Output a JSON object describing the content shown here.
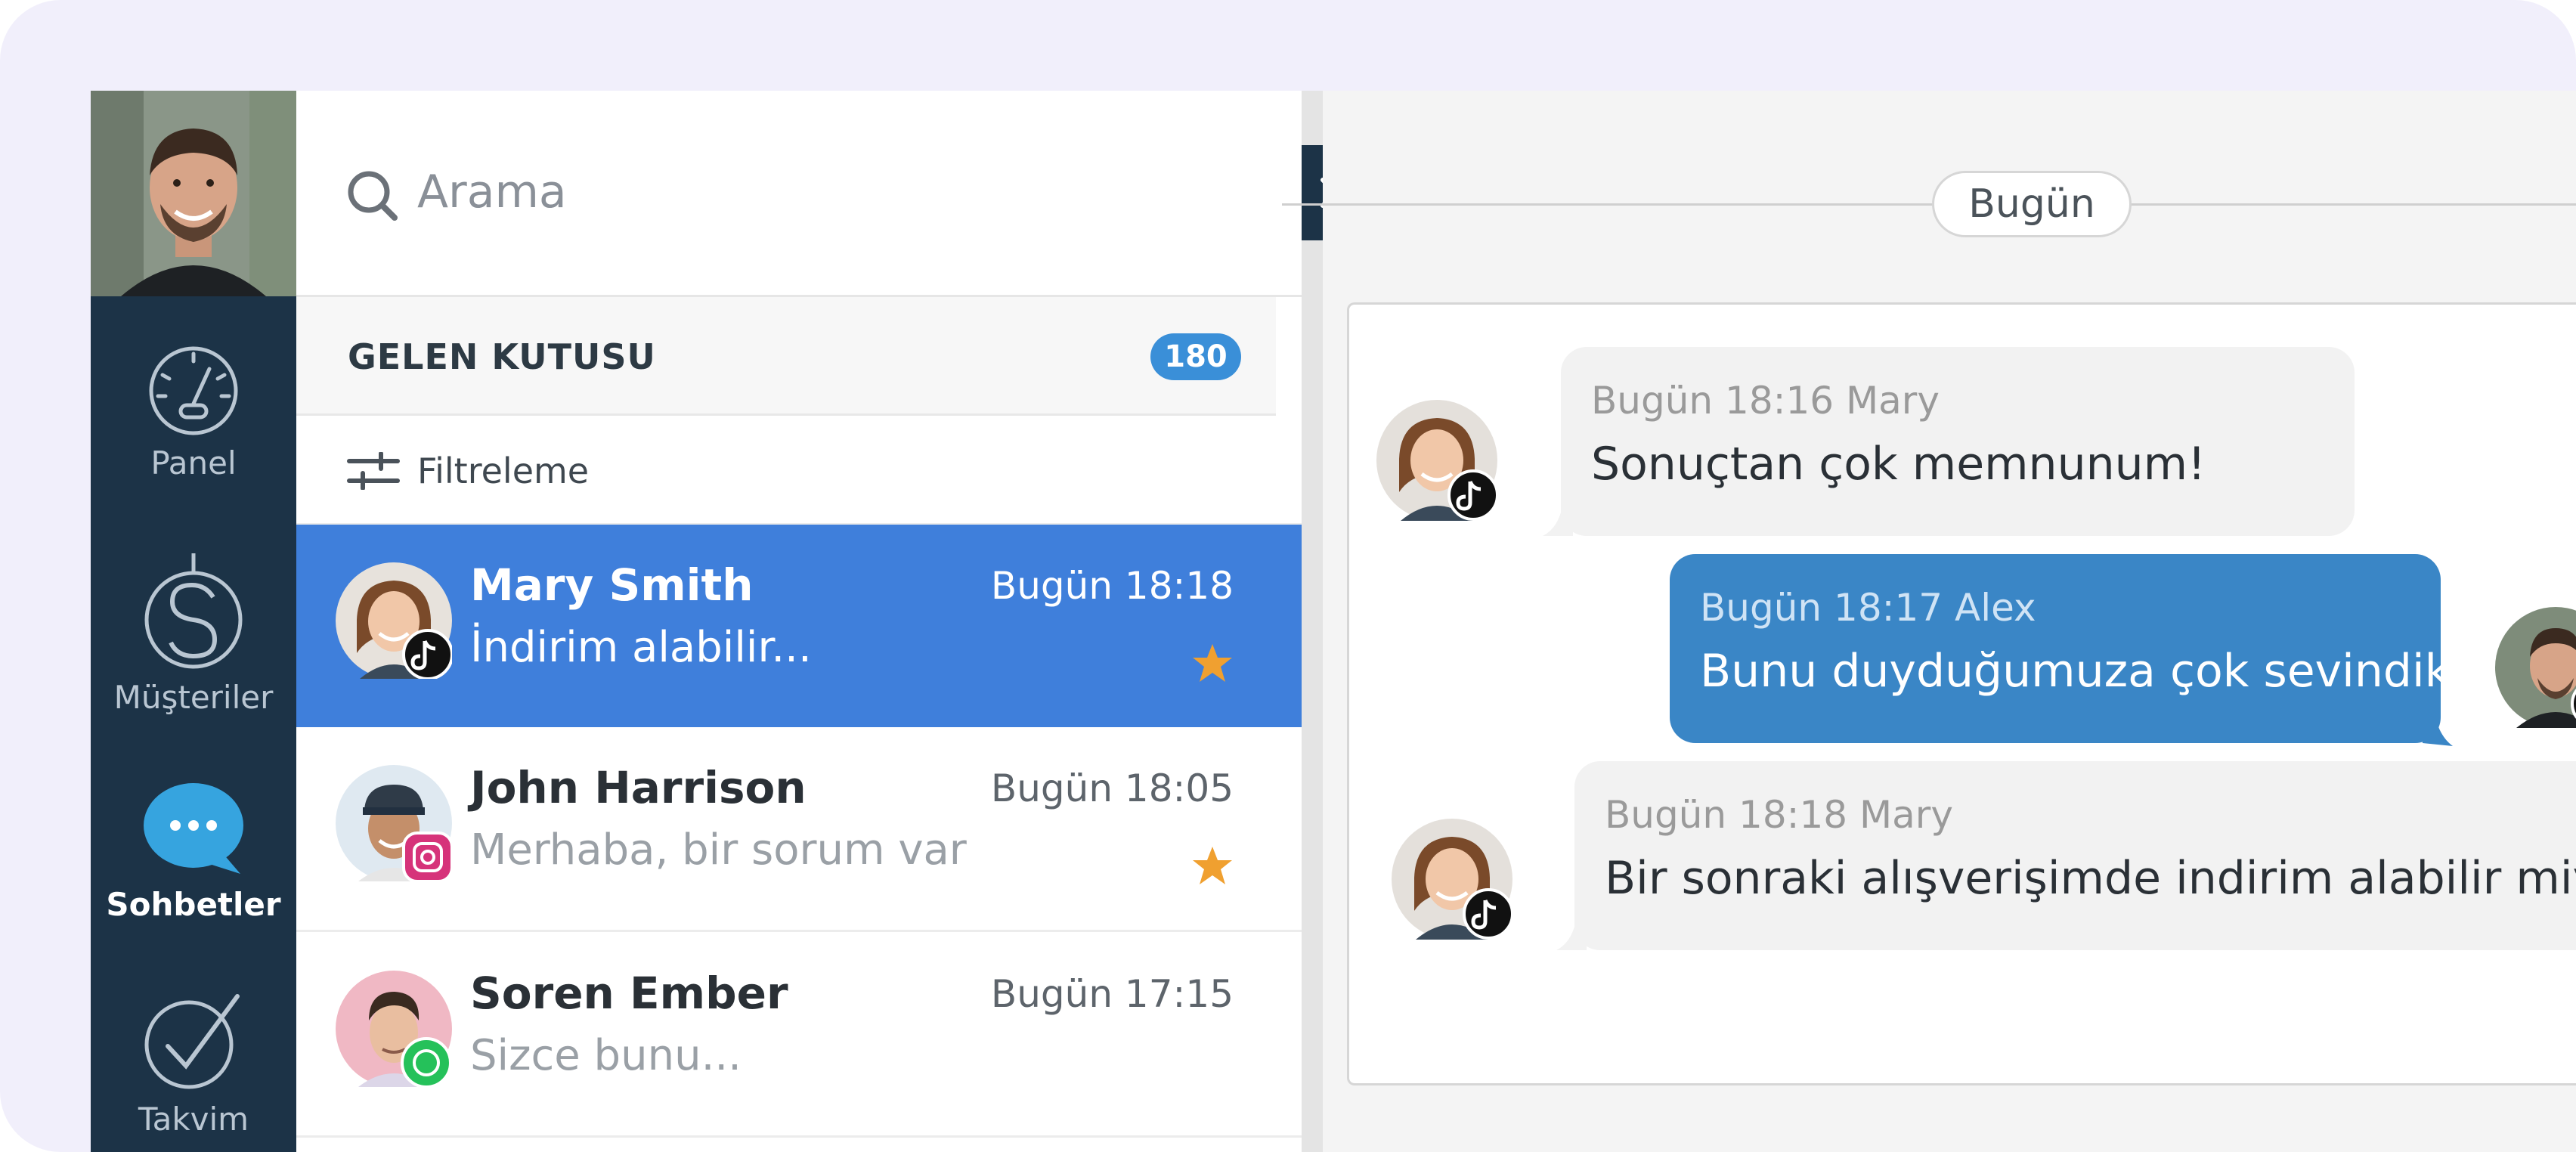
{
  "rail": {
    "items": [
      {
        "label": "Panel",
        "icon": "gauge-icon"
      },
      {
        "label": "Müşteriler",
        "icon": "dollar-icon"
      },
      {
        "label": "Sohbetler",
        "icon": "chat-bubble-icon"
      },
      {
        "label": "Takvim",
        "icon": "check-circle-icon"
      }
    ],
    "active": "Sohbetler"
  },
  "search": {
    "placeholder": "Arama"
  },
  "inbox": {
    "title": "GELEN KUTUSU",
    "count": "180"
  },
  "filter": {
    "label": "Filtreleme"
  },
  "conversations": [
    {
      "name": "Mary Smith",
      "time": "Bugün 18:18",
      "preview": "İndirim alabilir...",
      "channel": "tiktok",
      "starred": true,
      "active": true
    },
    {
      "name": "John Harrison",
      "time": "Bugün 18:05",
      "preview": "Merhaba, bir sorum var",
      "channel": "instagram",
      "starred": true,
      "active": false
    },
    {
      "name": "Soren Ember",
      "time": "Bugün 17:15",
      "preview": "Sizce bunu...",
      "channel": "whatsapp",
      "starred": false,
      "active": false
    }
  ],
  "chat": {
    "day": "Bugün",
    "messages": [
      {
        "direction": "in",
        "meta": "Bugün 18:16 Mary",
        "text": "Sonuçtan çok memnunum!",
        "channel": "tiktok"
      },
      {
        "direction": "out",
        "meta": "Bugün 18:17 Alex",
        "text": "Bunu duyduğumuza çok sevindik!",
        "channel": "tiktok"
      },
      {
        "direction": "in",
        "meta": "Bugün 18:18 Mary",
        "text": "Bir sonraki alışverişimde indirim alabilir miyim?",
        "channel": "tiktok"
      }
    ]
  },
  "colors": {
    "rail": "#1c3347",
    "active_row": "#3f7fdb",
    "badge": "#3a8fd8",
    "outgoing_bubble": "#3a86c6",
    "star": "#f0a030",
    "backdrop": "#f1effb"
  }
}
